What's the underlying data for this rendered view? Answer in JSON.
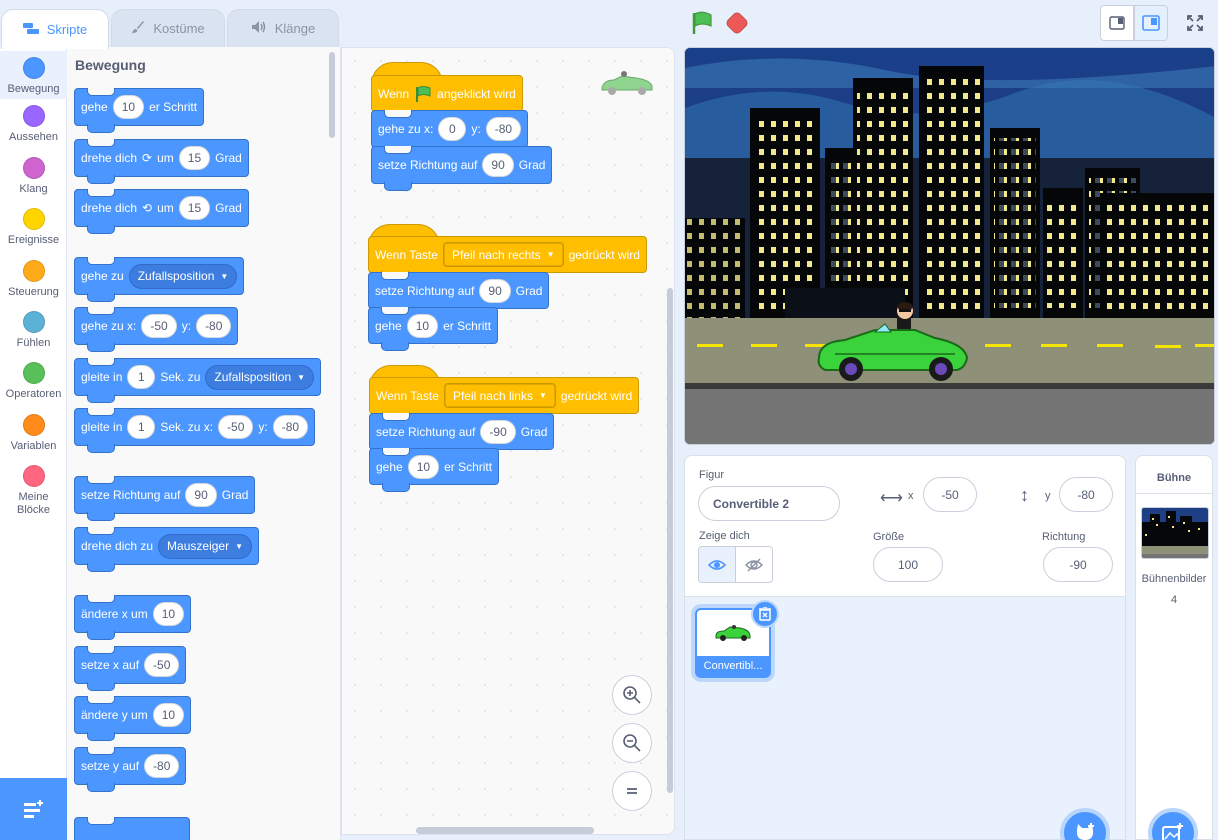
{
  "tabs": [
    {
      "label": "Skripte"
    },
    {
      "label": "Kostüme"
    },
    {
      "label": "Klänge"
    }
  ],
  "categories": [
    {
      "label": "Bewegung",
      "color": "#4c97ff"
    },
    {
      "label": "Aussehen",
      "color": "#9966ff"
    },
    {
      "label": "Klang",
      "color": "#cf63cf"
    },
    {
      "label": "Ereignisse",
      "color": "#ffd500"
    },
    {
      "label": "Steuerung",
      "color": "#ffab19"
    },
    {
      "label": "Fühlen",
      "color": "#5cb1d6"
    },
    {
      "label": "Operatoren",
      "color": "#59c059"
    },
    {
      "label": "Variablen",
      "color": "#ff8c1a"
    },
    {
      "label": "Meine Blöcke",
      "color": "#ff6680"
    }
  ],
  "palette": {
    "title": "Bewegung",
    "b1": {
      "t1": "gehe",
      "v1": "10",
      "t2": "er Schritt"
    },
    "b2": {
      "t1": "drehe dich",
      "t2": "um",
      "v1": "15",
      "t3": "Grad"
    },
    "b3": {
      "t1": "drehe dich",
      "t2": "um",
      "v1": "15",
      "t3": "Grad"
    },
    "b4": {
      "t1": "gehe zu",
      "d1": "Zufallsposition"
    },
    "b5": {
      "t1": "gehe zu x:",
      "v1": "-50",
      "t2": "y:",
      "v2": "-80"
    },
    "b6": {
      "t1": "gleite in",
      "v1": "1",
      "t2": "Sek. zu",
      "d1": "Zufallsposition"
    },
    "b7": {
      "t1": "gleite in",
      "v1": "1",
      "t2": "Sek. zu x:",
      "v2": "-50",
      "t3": "y:",
      "v3": "-80"
    },
    "b8": {
      "t1": "setze Richtung auf",
      "v1": "90",
      "t2": "Grad"
    },
    "b9": {
      "t1": "drehe dich zu",
      "d1": "Mauszeiger"
    },
    "b10": {
      "t1": "ändere x um",
      "v1": "10"
    },
    "b11": {
      "t1": "setze x auf",
      "v1": "-50"
    },
    "b12": {
      "t1": "ändere y um",
      "v1": "10"
    },
    "b13": {
      "t1": "setze y auf",
      "v1": "-80"
    }
  },
  "workspace": {
    "s1": {
      "hat_t1": "Wenn",
      "hat_t2": "angeklickt wird",
      "b1_t1": "gehe zu x:",
      "b1_v1": "0",
      "b1_t2": "y:",
      "b1_v2": "-80",
      "b2_t1": "setze Richtung auf",
      "b2_v1": "90",
      "b2_t2": "Grad"
    },
    "s2": {
      "hat_t1": "Wenn Taste",
      "hat_d1": "Pfeil nach rechts",
      "hat_t2": "gedrückt wird",
      "b1_t1": "setze Richtung auf",
      "b1_v1": "90",
      "b1_t2": "Grad",
      "b2_t1": "gehe",
      "b2_v1": "10",
      "b2_t2": "er Schritt"
    },
    "s3": {
      "hat_t1": "Wenn Taste",
      "hat_d1": "Pfeil nach links",
      "hat_t2": "gedrückt wird",
      "b1_t1": "setze Richtung auf",
      "b1_v1": "-90",
      "b1_t2": "Grad",
      "b2_t1": "gehe",
      "b2_v1": "10",
      "b2_t2": "er Schritt"
    }
  },
  "sprite_info": {
    "figur_label": "Figur",
    "name": "Convertible 2",
    "x_label": "x",
    "x": "-50",
    "y_label": "y",
    "y": "-80",
    "show_label": "Zeige dich",
    "size_label": "Größe",
    "size": "100",
    "dir_label": "Richtung",
    "direction": "-90"
  },
  "sprites": [
    {
      "name": "Convertibl..."
    }
  ],
  "stage_panel": {
    "title": "Bühne",
    "backdrops_label": "Bühnenbilder",
    "backdrops_count": "4"
  },
  "colors": {
    "motion": "#4c97ff",
    "events": "#ffbf00",
    "accent": "#4c97ff"
  }
}
